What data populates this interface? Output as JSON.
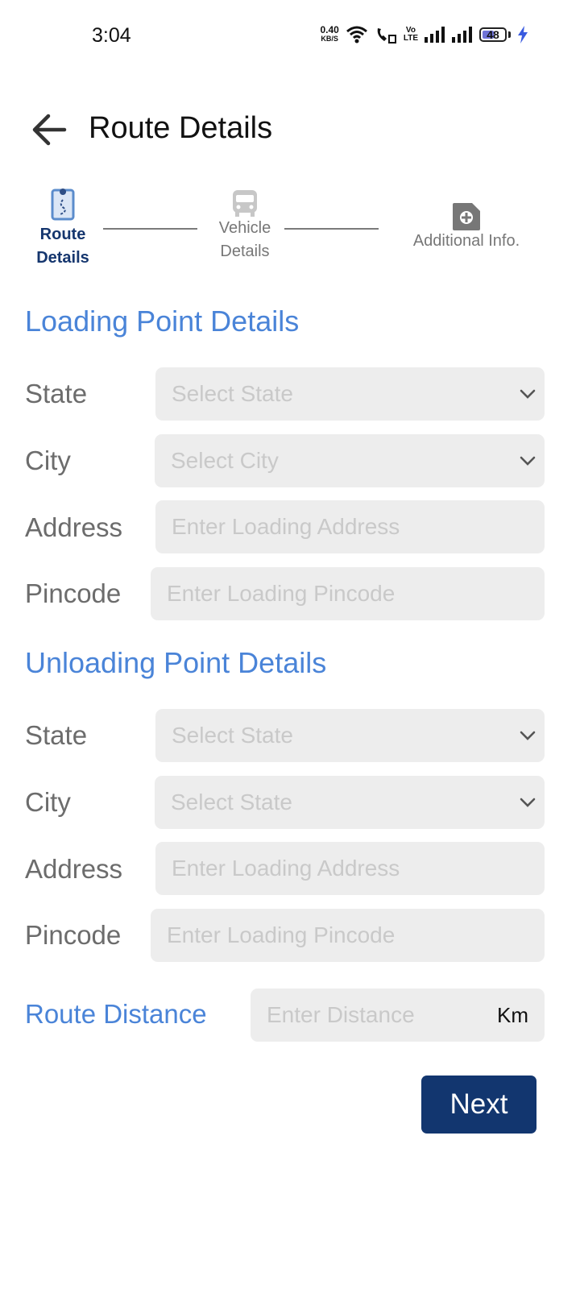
{
  "status_bar": {
    "time": "3:04",
    "net_speed_value": "0.40",
    "net_speed_unit": "KB/S",
    "volte": "Vo\nLTE",
    "battery": "48"
  },
  "header": {
    "title": "Route Details",
    "back_icon": "arrow-left-icon"
  },
  "stepper": {
    "steps": [
      {
        "label": "Route\nDetails",
        "icon": "route-map-icon",
        "active": true
      },
      {
        "label": "Vehicle\nDetails",
        "icon": "bus-icon",
        "active": false
      },
      {
        "label": "Additional Info.",
        "icon": "document-plus-icon",
        "active": false
      }
    ]
  },
  "loading": {
    "title": "Loading Point Details",
    "state_label": "State",
    "state_placeholder": "Select State",
    "city_label": "City",
    "city_placeholder": "Select City",
    "address_label": "Address",
    "address_placeholder": "Enter Loading Address",
    "pincode_label": "Pincode",
    "pincode_placeholder": "Enter Loading Pincode"
  },
  "unloading": {
    "title": "Unloading Point Details",
    "state_label": "State",
    "state_placeholder": "Select State",
    "city_label": "City",
    "city_placeholder": "Select State",
    "address_label": "Address",
    "address_placeholder": "Enter Loading Address",
    "pincode_label": "Pincode",
    "pincode_placeholder": "Enter Loading Pincode"
  },
  "route_distance": {
    "label": "Route Distance",
    "placeholder": "Enter Distance",
    "unit": "Km"
  },
  "next_label": "Next",
  "colors": {
    "accent_blue": "#4a84d8",
    "primary_navy": "#12366f",
    "field_bg": "#ededed"
  }
}
